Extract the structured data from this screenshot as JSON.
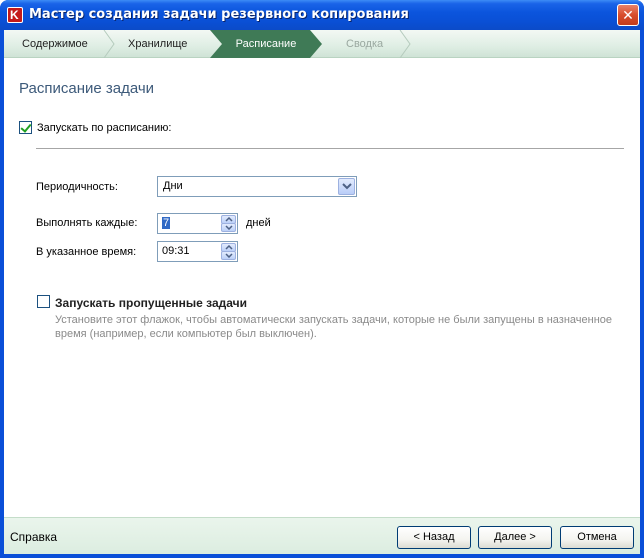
{
  "window": {
    "title": "Мастер создания задачи резервного копирования",
    "close_glyph": "✕"
  },
  "steps": [
    {
      "label": "Содержимое",
      "state": "done"
    },
    {
      "label": "Хранилище",
      "state": "done"
    },
    {
      "label": "Расписание",
      "state": "active"
    },
    {
      "label": "Сводка",
      "state": "future"
    }
  ],
  "main": {
    "heading": "Расписание задачи",
    "run_on_schedule": {
      "label": "Запускать по расписанию:",
      "checked": true
    },
    "frequency": {
      "label": "Периодичность:",
      "value": "Дни"
    },
    "every": {
      "label": "Выполнять каждые:",
      "value": "7",
      "units": "дней"
    },
    "time": {
      "label": "В указанное время:",
      "value": "09:31"
    },
    "run_missed": {
      "label": "Запускать пропущенные задачи",
      "checked": false,
      "description": "Установите этот флажок, чтобы автоматически запускать задачи, которые не были запущены в назначенное время (например, если компьютер был выключен)."
    }
  },
  "footer": {
    "help": "Справка",
    "back": "< Назад",
    "next": "Далее >",
    "cancel": "Отмена"
  },
  "colors": {
    "titlebar": "#0b55dd",
    "active_step": "#3f7a56",
    "heading": "#3d5a7a",
    "footer_bg": "#dcede0"
  },
  "icons": {
    "app": "kaspersky-k-icon",
    "close": "close-icon",
    "combo": "chevron-down-icon",
    "spin_up": "arrow-up-icon",
    "spin_down": "arrow-down-icon"
  }
}
